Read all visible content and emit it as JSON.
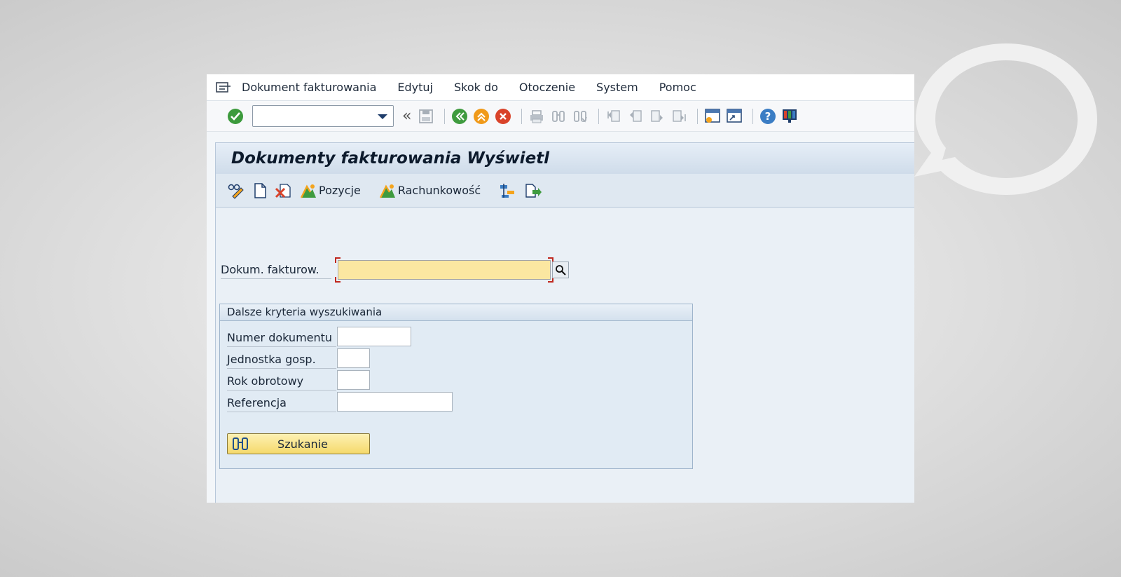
{
  "menubar": {
    "items": [
      {
        "label": "Dokument fakturowania"
      },
      {
        "label": "Edytuj"
      },
      {
        "label": "Skok do"
      },
      {
        "label": "Otoczenie"
      },
      {
        "label": "System"
      },
      {
        "label": "Pomoc"
      }
    ]
  },
  "toolbar": {
    "command_field_value": "",
    "icons": [
      "enter-check-icon",
      "back-icon",
      "exit-icon",
      "cancel-icon",
      "print-icon",
      "find-icon",
      "find-next-icon",
      "first-page-icon",
      "previous-page-icon",
      "next-page-icon",
      "last-page-icon",
      "new-session-icon",
      "shortcut-icon",
      "help-icon",
      "layout-icon"
    ]
  },
  "title": "Dokumenty fakturowania Wyświetl",
  "app_toolbar": {
    "items": [
      {
        "icon": "display-change-icon"
      },
      {
        "icon": "create-document-icon"
      },
      {
        "icon": "cancel-document-icon"
      },
      {
        "icon": "items-overview-icon",
        "label": "Pozycje"
      },
      {
        "icon": "accounting-icon",
        "label": "Rachunkowość"
      },
      {
        "icon": "document-flow-icon"
      },
      {
        "icon": "output-icon"
      }
    ]
  },
  "main_field": {
    "label": "Dokum. fakturow.",
    "value": ""
  },
  "search_group": {
    "title": "Dalsze kryteria wyszukiwania",
    "fields": [
      {
        "label": "Numer dokumentu",
        "value": ""
      },
      {
        "label": "Jednostka gosp.",
        "value": ""
      },
      {
        "label": "Rok obrotowy",
        "value": ""
      },
      {
        "label": "Referencja",
        "value": ""
      }
    ],
    "button_label": "Szukanie"
  },
  "colors": {
    "required_field": "#fbe7a1",
    "search_button": "#f5d96b",
    "title_text": "#0c1a2c"
  }
}
